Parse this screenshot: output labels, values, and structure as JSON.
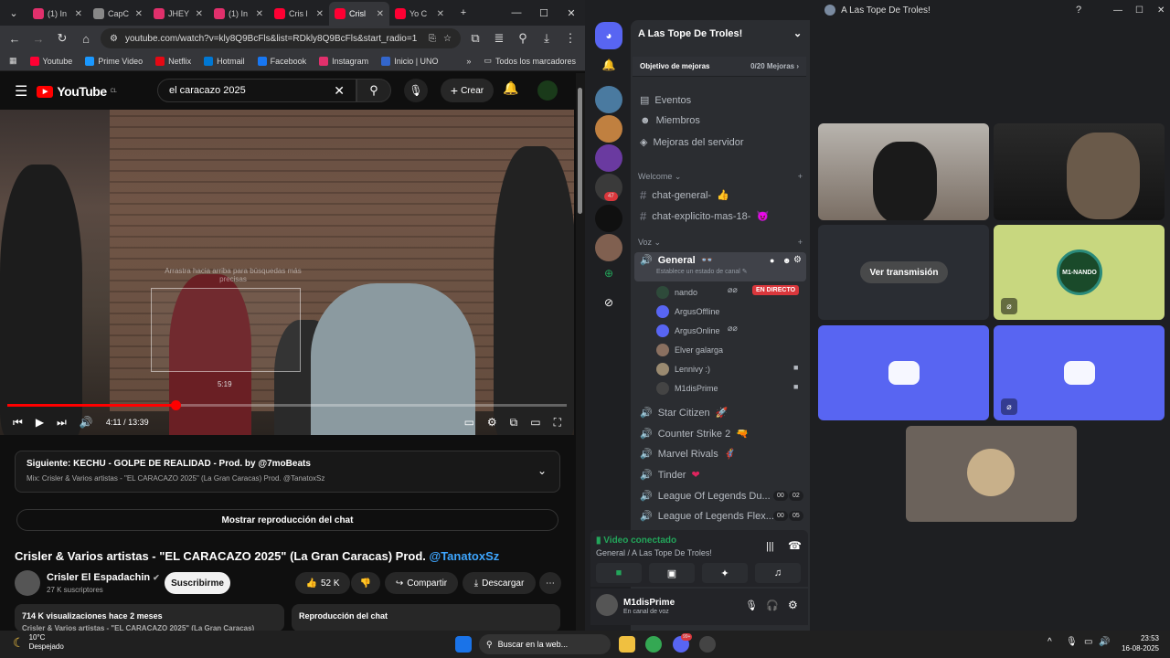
{
  "chrome": {
    "tabs": [
      {
        "label": "(1) In",
        "color": "#e1306c"
      },
      {
        "label": "CapC",
        "color": "#888888"
      },
      {
        "label": "JHEY",
        "color": "#e1306c"
      },
      {
        "label": "(1) In",
        "color": "#e1306c"
      },
      {
        "label": "Cris l",
        "color": "#ff0033"
      },
      {
        "label": "Crisl",
        "color": "#ff0033"
      },
      {
        "label": "Yo C",
        "color": "#ff0033"
      }
    ],
    "url": "youtube.com/watch?v=kly8Q9BcFls&list=RDkly8Q9BcFls&start_radio=1",
    "bookmarks": [
      {
        "label": "Youtube",
        "color": "#ff0033"
      },
      {
        "label": "Prime Video",
        "color": "#1a98ff"
      },
      {
        "label": "Netflix",
        "color": "#e50914"
      },
      {
        "label": "Hotmail",
        "color": "#0078d4"
      },
      {
        "label": "Facebook",
        "color": "#1877f2"
      },
      {
        "label": "Instagram",
        "color": "#e1306c"
      },
      {
        "label": "Inicio | UNO",
        "color": "#3366cc"
      }
    ],
    "all_bookmarks": "Todos los marcadores"
  },
  "youtube": {
    "logo": "YouTube",
    "region": "CL",
    "search_value": "el caracazo 2025",
    "create": "Crear",
    "drag_hint": "Arrastra hacia arriba para búsquedas más precisas",
    "preview_time": "5:19",
    "time": "4:11 / 13:39",
    "progress_fraction": 0.3,
    "next_title": "Siguiente: KECHU - GOLPE DE REALIDAD - Prod. by @7moBeats",
    "next_sub": "Mix: Crisler & Varios artistas - \"EL CARACAZO 2025\" (La Gran Caracas) Prod. @TanatoxSz",
    "chat_replay": "Mostrar reproducción del chat",
    "title": "Crisler & Varios artistas - \"EL CARACAZO 2025\" (La Gran Caracas) Prod. ",
    "title_tag": "@TanatoxSz",
    "channel": "Crisler El Espadachin",
    "subscribers": "27 K suscriptores",
    "subscribe": "Suscribirme",
    "likes": "52 K",
    "share": "Compartir",
    "download": "Descargar",
    "views": "714 K visualizaciones  hace 2 meses",
    "views_sub": "Crisler & Varios artistas - \"EL CARACAZO 2025\" (La Gran Caracas)",
    "replay_box": "Reproducción del chat"
  },
  "discord": {
    "window_title": "A Las Tope De Troles!",
    "guild": "A Las Tope De Troles!",
    "goal": "Objetivo de mejoras",
    "goal_count": "0/20 Mejoras",
    "nav": [
      "Eventos",
      "Miembros",
      "Mejoras del servidor"
    ],
    "cat_welcome": "Welcome",
    "text_channels": [
      "chat-general-",
      "chat-explicito-mas-18-"
    ],
    "cat_voz": "Voz",
    "general": "General",
    "general_status": "Establece un estado de canal",
    "voice_users": [
      "nando",
      "ArgusOffline",
      "ArgusOnline",
      "Elver galarga",
      "Lennivy :)",
      "M1disPrime"
    ],
    "live": "EN DIRECTO",
    "voice_channels": [
      "Star Citizen",
      "Counter Strike 2",
      "Marvel Rivals",
      "Tinder",
      "League Of Legends Du...",
      "League of Legends Flex..."
    ],
    "counts": [
      [
        "00",
        "02"
      ],
      [
        "00",
        "05"
      ]
    ],
    "badge_47": "47",
    "voice_connected": "Video conectado",
    "voice_location": "General   / A Las Tope De Troles!",
    "me": "M1disPrime",
    "me_status": "En canal de voz",
    "watch_stream": "Ver transmisión",
    "tile_logo_text": "M1-NANDO"
  },
  "taskbar": {
    "temp": "10°C",
    "weather": "Despejado",
    "search": "Buscar en la web...",
    "time": "23:53",
    "date": "16-08-2025",
    "badge": "99+"
  },
  "colors": {
    "yt_red": "#ff0000",
    "discord_blurple": "#5865f2",
    "tile_green": "#c8d77f"
  }
}
